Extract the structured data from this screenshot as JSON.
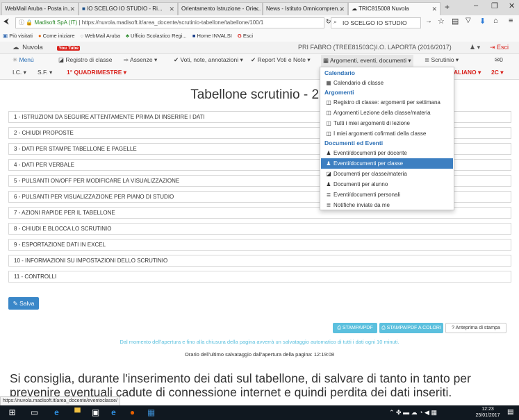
{
  "browser": {
    "tabs": [
      {
        "label": "WebMail Aruba - Posta in..."
      },
      {
        "label": "IO SCELGO IO STUDIO - Ri..."
      },
      {
        "label": "Orientamento Istruzione - Orie..."
      },
      {
        "label": "News - Istituto Omnicompren..."
      },
      {
        "label": "TRIC815008 Nuvola"
      }
    ],
    "url_secure": "Madisoft SpA (IT)",
    "url": "https://nuvola.madisoft.it/area_docente/scrutinio-tabellone/tabellone/100/1",
    "search_value": "IO SCELGO IO STUDIO",
    "bookmarks": [
      "Più visitati",
      "Come iniziare",
      "WebMail Aruba",
      "Ufficio Scolastico Regi...",
      "Home INVALSI",
      "Esci"
    ],
    "status_url": "https://nuvola.madisoft.it/area_docente/eventoclasse/"
  },
  "app": {
    "brand": "Nuvola",
    "youtube": "You Tube",
    "teacher": "PRI FABRO (TREE81503C)",
    "school": "I.O. LAPORTA (2016/2017)",
    "exit": "Esci",
    "menu": {
      "menu": "Menù",
      "registro": "Registro di classe",
      "assenze": "Assenze",
      "voti": "Voti, note, annotazioni",
      "report": "Report Voti e Note",
      "argomenti": "Argomenti, eventi, documenti",
      "scrutinio": "Scrutinio",
      "msg_count": "0"
    },
    "subbar": {
      "ic": "I.C.",
      "sf": "S.F.",
      "period": "1° QUADRIMESTRE",
      "subject": "ALIANO",
      "class": "2C"
    }
  },
  "dropdown": {
    "calendario_head": "Calendario",
    "calendario_item": "Calendario di classe",
    "argomenti_head": "Argomenti",
    "argomenti_items": [
      "Registro di classe: argomenti per settimana",
      "Argomenti Lezione della classe/materia",
      "Tutti i miei argomenti di lezione",
      "I miei argomenti cofirmati della classe"
    ],
    "eventi_head": "Documenti ed Eventi",
    "eventi_items": [
      "Eventi/documenti per docente",
      "Eventi/documenti per classe",
      "Documenti per classe/materia",
      "Documenti per alunno",
      "Eventi/documenti personali",
      "Notifiche inviate da me"
    ]
  },
  "page": {
    "title": "Tabellone scrutinio - 2C",
    "sections": [
      "1 - ISTRUZIONI DA SEGUIRE ATTENTAMENTE PRIMA DI INSERIRE I DATI",
      "2 - CHIUDI PROPOSTE",
      "3 - DATI PER STAMPE TABELLONE E PAGELLE",
      "4 - DATI PER VERBALE",
      "5 - PULSANTI ON/OFF PER MODIFICARE LA VISUALIZZAZIONE",
      "6 - PULSANTI PER VISUALIZZAZIONE PER PIANO DI STUDIO",
      "7 - AZIONI RAPIDE PER IL TABELLONE",
      "8 - CHIUDI E BLOCCA LO SCRUTINIO",
      "9 - ESPORTAZIONE DATI IN EXCEL",
      "10 - INFORMAZIONI SU IMPOSTAZIONI DELLO SCRUTINIO",
      "11 - CONTROLLI"
    ],
    "save": "Salva",
    "stampa_pdf": "STAMPA/PDF",
    "stampa_colori": "STAMPA/PDF A COLORI",
    "anteprima": "Anteprima di stampa",
    "autosave_info": "Dal momento dell'apertura e fino alla chiusura della pagina avverrà un salvataggio automatico di tutti i dati ogni 10 minuti.",
    "last_save": "Orario dell'ultimo salvataggio dall'apertura della pagina: 12:19:08",
    "advice": "Si consiglia, durante l'inserimento dei dati sul tabellone, di salvare di tanto in tanto per prevenire eventuali cadute di connessione internet e quindi perdita dei dati inseriti."
  },
  "taskbar": {
    "time": "12:23",
    "date": "25/01/2017"
  },
  "colors": {
    "accent": "#3d7fc1",
    "red": "#d9231d",
    "info": "#5bc0de"
  }
}
